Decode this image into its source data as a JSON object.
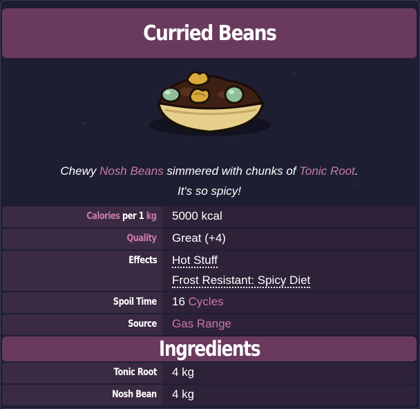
{
  "item": {
    "title": "Curried Beans",
    "description": {
      "part1": "Chewy ",
      "link1": "Nosh Beans",
      "part2": " simmered with chunks of ",
      "link2": "Tonic Root",
      "part3": ".",
      "line2": "It's so spicy!"
    }
  },
  "stats": {
    "calories": {
      "label_a": "Calories",
      "label_b": " per 1 ",
      "label_c": "kg",
      "value": "5000 kcal"
    },
    "quality": {
      "label": "Quality",
      "value": "Great (+4)"
    },
    "effects": {
      "label": "Effects",
      "values": [
        "Hot Stuff",
        "Frost Resistant: Spicy Diet"
      ]
    },
    "spoil_time": {
      "label": "Spoil Time",
      "value_num": "16 ",
      "value_unit": "Cycles"
    },
    "source": {
      "label": "Source",
      "value": "Gas Range"
    }
  },
  "ingredients": {
    "title": "Ingredients",
    "items": [
      {
        "name": "Tonic Root",
        "amount": "4 kg"
      },
      {
        "name": "Nosh Bean",
        "amount": "4 kg"
      }
    ]
  },
  "colors": {
    "accent": "#6a3a5e",
    "link": "#c87aa8",
    "background": "#1e1e33"
  },
  "icons": {
    "dish": "curried-beans-dish-icon"
  }
}
